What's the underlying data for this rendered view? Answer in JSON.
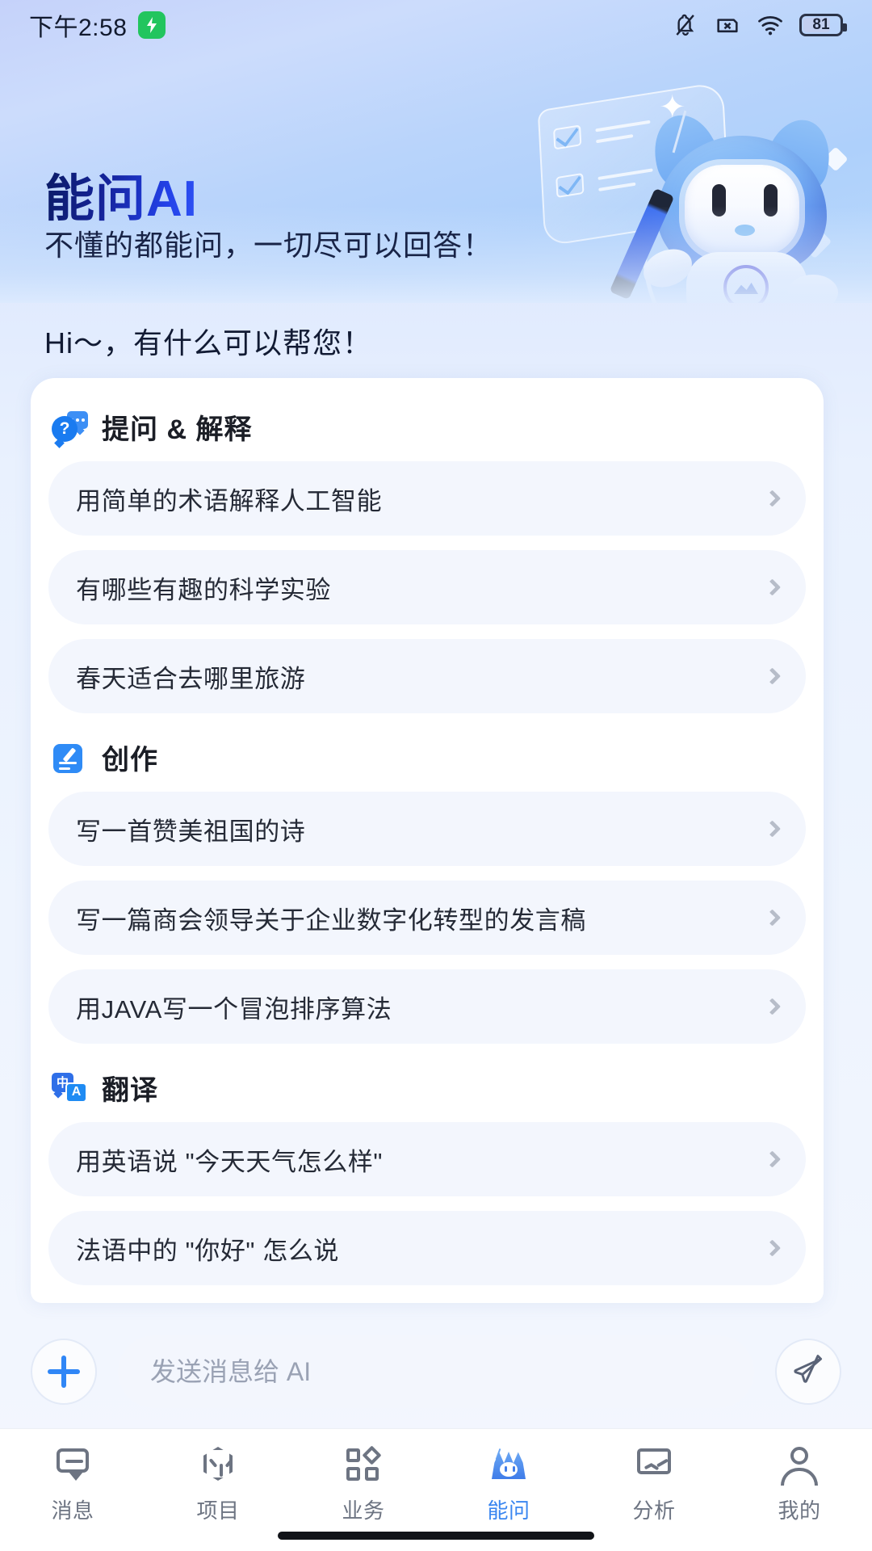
{
  "status_bar": {
    "time": "下午2:58",
    "battery_percent": "81",
    "icons": [
      "leaf-saver-icon",
      "bell-muted-icon",
      "sim-x-icon",
      "wifi-icon",
      "battery-icon"
    ]
  },
  "hero": {
    "title": "能问AI",
    "subtitle": "不懂的都能问，一切尽可以回答！",
    "mascot": "blue-cat-robot-mascot"
  },
  "greeting": "Hi～，有什么可以帮您！",
  "sections": [
    {
      "icon": "question-bubble-icon",
      "title": "提问 & 解释",
      "items": [
        "用简单的术语解释人工智能",
        "有哪些有趣的科学实验",
        "春天适合去哪里旅游"
      ]
    },
    {
      "icon": "edit-note-icon",
      "title": "创作",
      "items": [
        "写一首赞美祖国的诗",
        "写一篇商会领导关于企业数字化转型的发言稿",
        "用JAVA写一个冒泡排序算法"
      ]
    },
    {
      "icon": "translate-icon",
      "title": "翻译",
      "items": [
        "用英语说 \"今天天气怎么样\"",
        "法语中的 \"你好\" 怎么说"
      ]
    }
  ],
  "input_bar": {
    "add_icon": "plus-icon",
    "placeholder": "发送消息给 AI",
    "value": "",
    "send_icon": "send-paper-plane-icon"
  },
  "bottom_nav": {
    "active_index": 3,
    "items": [
      {
        "label": "消息",
        "icon": "message-bubble-icon"
      },
      {
        "label": "项目",
        "icon": "cube-box-icon"
      },
      {
        "label": "业务",
        "icon": "grid-apps-icon"
      },
      {
        "label": "能问",
        "icon": "ai-cat-icon"
      },
      {
        "label": "分析",
        "icon": "chart-monitor-icon"
      },
      {
        "label": "我的",
        "icon": "user-person-icon"
      }
    ]
  },
  "colors": {
    "accent_blue": "#2f86f6",
    "title_gradient_from": "#0b1b63",
    "title_gradient_to": "#2f53f5",
    "chip_bg": "#f3f6fd",
    "nav_inactive": "#6d7482",
    "nav_active": "#3a86f0",
    "battery_saver_green": "#22c55e"
  }
}
